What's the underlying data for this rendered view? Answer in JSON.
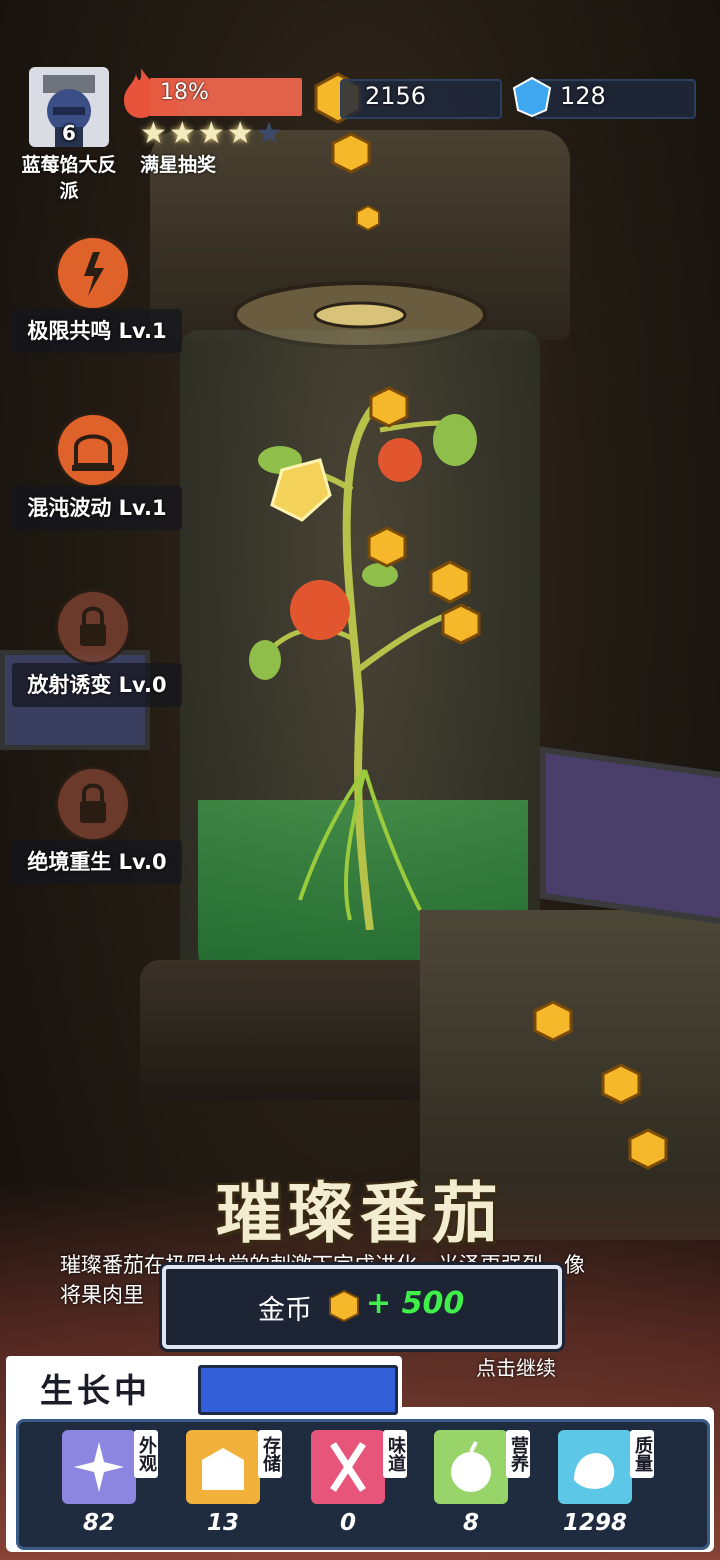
{
  "player": {
    "name": "蓝莓馅大反派",
    "level": "6"
  },
  "growth": {
    "percent_text": "18%",
    "stars_filled": 4,
    "stars_total": 5,
    "reward_label": "满星抽奖"
  },
  "currencies": {
    "coins": "2156",
    "gems": "128"
  },
  "skills": [
    {
      "label": "极限共鸣 Lv.1",
      "locked": false
    },
    {
      "label": "混沌波动 Lv.1",
      "locked": false
    },
    {
      "label": "放射诱变 Lv.0",
      "locked": true
    },
    {
      "label": "绝境重生 Lv.0",
      "locked": true
    }
  ],
  "fruit": {
    "title": "璀璨番茄",
    "description_line1": "璀璨番茄在极限协党的刺激下完成进化，光泽更强烈，像",
    "description_line2": "将果肉里"
  },
  "reward": {
    "name": "金币",
    "amount": "+ 500"
  },
  "continue_text": "点击继续",
  "status": {
    "label": "生长中"
  },
  "stats": [
    {
      "tag": "外观",
      "value": "82",
      "color": "#8d86e0",
      "icon": "sparkle-icon"
    },
    {
      "tag": "存储",
      "value": "13",
      "color": "#f2b13a",
      "icon": "box-icon"
    },
    {
      "tag": "味道",
      "value": "0",
      "color": "#e8557a",
      "icon": "utensils-icon"
    },
    {
      "tag": "营养",
      "value": "8",
      "color": "#98d46a",
      "icon": "fruit-icon"
    },
    {
      "tag": "质量",
      "value": "1298",
      "color": "#5cc7e6",
      "icon": "muscle-icon"
    }
  ],
  "colors": {
    "accent_orange": "#e0622b",
    "progress_red": "#e85b43",
    "reward_green": "#3ff04a",
    "status_blue": "#3360d8"
  }
}
